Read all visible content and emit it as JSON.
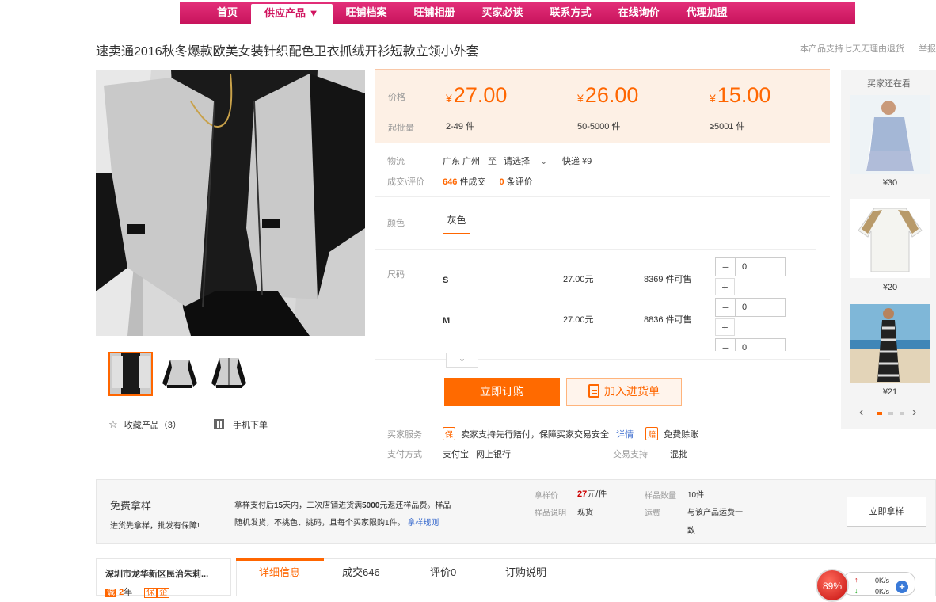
{
  "nav": [
    "首页",
    "供应产品 ▼",
    "旺铺档案",
    "旺铺相册",
    "买家必读",
    "联系方式",
    "在线询价",
    "代理加盟"
  ],
  "product": {
    "title": "速卖通2016秋冬爆款欧美女装针织配色卫衣抓绒开衫短款立领小外套"
  },
  "top_notes": {
    "return": "本产品支持七天无理由退货",
    "report": "举报"
  },
  "price": {
    "label_price": "价格",
    "label_moq": "起批量",
    "currency": "¥",
    "tiers": [
      {
        "price": "27.00",
        "qty": "2-49 件"
      },
      {
        "price": "26.00",
        "qty": "50-5000 件"
      },
      {
        "price": "15.00",
        "qty": "≥5001 件"
      }
    ]
  },
  "logistics": {
    "label": "物流",
    "from": "广东 广州",
    "to": "至",
    "select": "请选择",
    "express": "快递 ¥9"
  },
  "deals": {
    "label": "成交\\评价",
    "count": "646",
    "count_suffix": "件成交",
    "reviews": "0",
    "reviews_suffix": "条评价"
  },
  "color": {
    "label": "颜色",
    "option": "灰色"
  },
  "sizes": {
    "label": "尺码",
    "rows": [
      {
        "name": "S",
        "price": "27.00元",
        "stock": "8369 件可售",
        "qty": "0"
      },
      {
        "name": "M",
        "price": "27.00元",
        "stock": "8836 件可售",
        "qty": "0"
      },
      {
        "qty": "0"
      }
    ]
  },
  "actions": {
    "buy": "立即订购",
    "cart": "加入进货单"
  },
  "service": {
    "label": "买家服务",
    "badge1": "保",
    "text": "卖家支持先行赔付，保障买家交易安全",
    "detail": "详情",
    "badge2": "赔",
    "free": "免费赊账",
    "pay_label": "支付方式",
    "pay1": "支付宝",
    "pay2": "网上银行",
    "trade_label": "交易支持",
    "trade": "混批"
  },
  "favorites": {
    "label": "收藏产品（3）",
    "mobile": "手机下单"
  },
  "sidebar": {
    "title": "买家还在看",
    "items": [
      {
        "price": "¥30"
      },
      {
        "price": "¥20"
      },
      {
        "price": "¥21"
      }
    ]
  },
  "sample": {
    "title": "免费拿样",
    "subtitle": "进货先拿样，批发有保障!",
    "desc1a": "拿样支付后",
    "desc1b": "15",
    "desc1c": "天内，二次店铺进货满",
    "desc1d": "5000",
    "desc1e": "元返还样品费。样品",
    "desc2": "随机发货，不挑色、挑码，且每个买家限购1件。",
    "rules": "拿样规则",
    "price_label": "拿样价",
    "price": "27",
    "price_unit": "元/件",
    "qty_label": "样品数量",
    "qty": "10件",
    "note_label": "样品说明",
    "note": "现货",
    "ship_label": "运费",
    "ship1": "与该产品运费一",
    "ship2": "致",
    "button": "立即拿样"
  },
  "tabs": [
    "详细信息",
    "成交646",
    "评价0",
    "订购说明"
  ],
  "shop": {
    "name": "深圳市龙华新区民治朱莉...",
    "years": "2",
    "years_suffix": "年",
    "b1": "诚",
    "b2": "保",
    "b3": "企"
  },
  "widget": {
    "percent": "89%",
    "up": "0K/s",
    "down": "0K/s"
  }
}
